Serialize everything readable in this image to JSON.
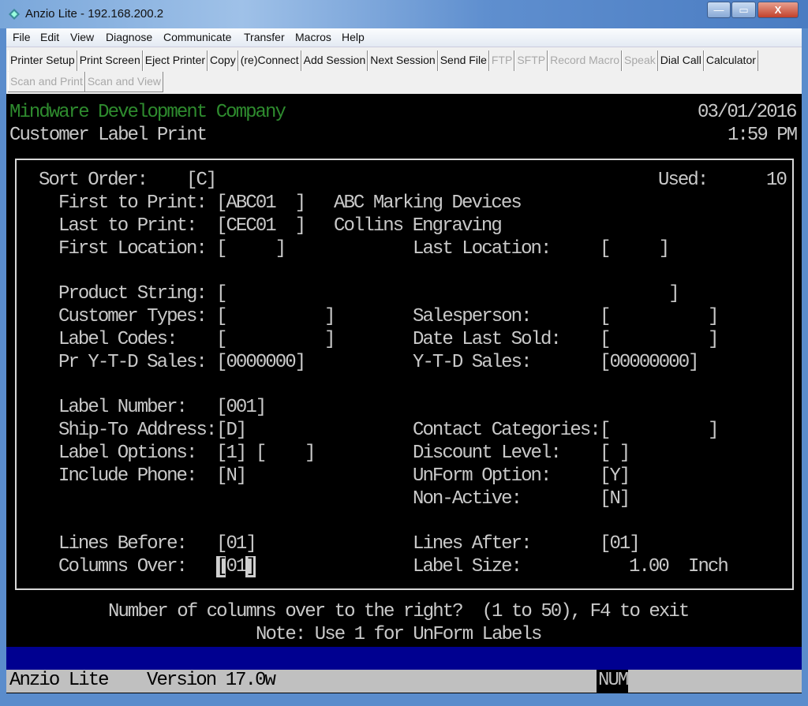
{
  "window": {
    "title": "Anzio Lite -  192.168.200.2",
    "minimize": "—",
    "maximize": "▭",
    "close": "X",
    "icon": "anzio-app-icon"
  },
  "menu": [
    "File",
    "Edit",
    "View",
    "Diagnose",
    "Communicate",
    "Transfer",
    "Macros",
    "Help"
  ],
  "toolbar": {
    "row1": [
      {
        "label": "Printer Setup",
        "enabled": true
      },
      {
        "label": "Print Screen",
        "enabled": true
      },
      {
        "label": "Eject Printer",
        "enabled": true
      },
      {
        "label": "Copy",
        "enabled": true
      },
      {
        "label": "(re)Connect",
        "enabled": true
      },
      {
        "label": "Add Session",
        "enabled": true
      },
      {
        "label": "Next Session",
        "enabled": true
      },
      {
        "label": "Send File",
        "enabled": true
      },
      {
        "label": "FTP",
        "enabled": false
      },
      {
        "label": "SFTP",
        "enabled": false
      },
      {
        "label": "Record Macro",
        "enabled": false
      },
      {
        "label": "Speak",
        "enabled": false
      },
      {
        "label": "Dial Call",
        "enabled": true
      },
      {
        "label": "Calculator",
        "enabled": true
      }
    ],
    "row2": [
      {
        "label": "Scan and Print",
        "enabled": false
      },
      {
        "label": "Scan and View",
        "enabled": false
      }
    ]
  },
  "terminal": {
    "company": "Mindware Development Company",
    "date": "03/01/2016",
    "screen_title": "Customer Label Print",
    "time": "1:59 PM",
    "sort_order": {
      "label": "Sort Order:",
      "value": "[C]"
    },
    "used": {
      "label": "Used:",
      "value": "10"
    },
    "first_to_print": {
      "label": "First to Print:",
      "value": "[ABC01  ]",
      "name": "ABC Marking Devices"
    },
    "last_to_print": {
      "label": "Last to Print:",
      "value": "[CEC01  ]",
      "name": "Collins Engraving"
    },
    "first_location": {
      "label": "First Location:",
      "value": "[     ]"
    },
    "last_location": {
      "label": "Last Location:",
      "value": "[     ]"
    },
    "product_string": {
      "label": "Product String:",
      "value": "[                                             ]"
    },
    "customer_types": {
      "label": "Customer Types:",
      "value": "[          ]"
    },
    "salesperson": {
      "label": "Salesperson:",
      "value": "[          ]"
    },
    "label_codes": {
      "label": "Label Codes:",
      "value": "[          ]"
    },
    "date_last_sold": {
      "label": "Date Last Sold:",
      "value": "[          ]"
    },
    "pr_ytd_sales": {
      "label": "Pr Y-T-D Sales:",
      "value": "[0000000]"
    },
    "ytd_sales": {
      "label": "Y-T-D Sales:",
      "value": "[00000000]"
    },
    "label_number": {
      "label": "Label Number:",
      "value": "[001]"
    },
    "ship_to_address": {
      "label": "Ship-To Address:",
      "value": "[D]"
    },
    "contact_categories": {
      "label": "Contact Categories:",
      "value": "[          ]"
    },
    "label_options": {
      "label": "Label Options:",
      "value": "[1] [    ]"
    },
    "discount_level": {
      "label": "Discount Level:",
      "value": "[ ]"
    },
    "include_phone": {
      "label": "Include Phone:",
      "value": "[N]"
    },
    "unform_option": {
      "label": "UnForm Option:",
      "value": "[Y]"
    },
    "non_active": {
      "label": "Non-Active:",
      "value": "[N]"
    },
    "lines_before": {
      "label": "Lines Before:",
      "value": "[01]"
    },
    "lines_after": {
      "label": "Lines After:",
      "value": "[01]"
    },
    "columns_over": {
      "label": "Columns Over:",
      "open": "[",
      "value": "01",
      "close": "]"
    },
    "label_size": {
      "label": "Label Size:",
      "value": "1.00",
      "unit": "Inch"
    },
    "prompt": "Number of columns over to the right?  (1 to 50), F4 to exit",
    "note": "Note: Use 1 for UnForm Labels",
    "status": {
      "app": "Anzio Lite",
      "version": "Version 17.0w",
      "num": "NUM"
    },
    "colors": {
      "company": "#2e8b2e",
      "text": "#c9c9c9",
      "bluebar": "#000090",
      "statusbar": "#c0c0c0"
    }
  }
}
